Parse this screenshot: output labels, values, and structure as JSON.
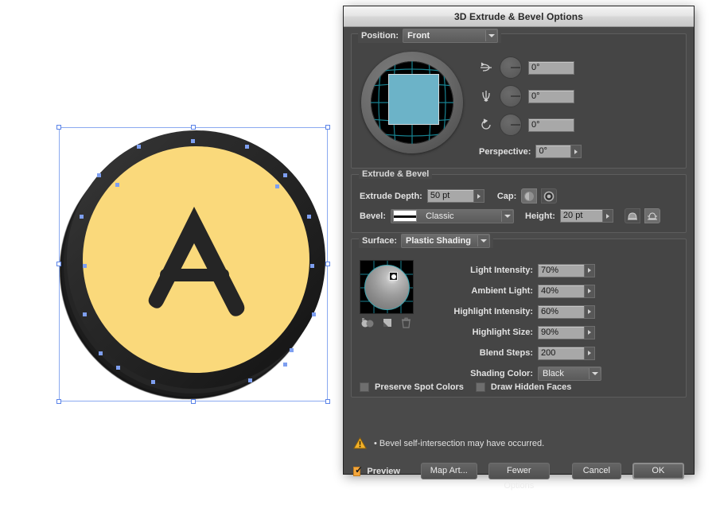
{
  "dialog": {
    "title": "3D Extrude & Bevel Options"
  },
  "position": {
    "label": "Position:",
    "value": "Front",
    "rotation_x": {
      "icon": "rotate-x-axis-icon",
      "value": "0°"
    },
    "rotation_y": {
      "icon": "rotate-y-axis-icon",
      "value": "0°"
    },
    "rotation_z": {
      "icon": "rotate-z-axis-icon",
      "value": "0°"
    },
    "perspective": {
      "label": "Perspective:",
      "value": "0°"
    }
  },
  "extrude": {
    "legend": "Extrude & Bevel",
    "depth_label": "Extrude Depth:",
    "depth_value": "50 pt",
    "cap_label": "Cap:",
    "cap_solid_icon": "cap-solid-icon",
    "cap_hollow_icon": "cap-hollow-icon",
    "bevel_label": "Bevel:",
    "bevel_value": "Classic",
    "height_label": "Height:",
    "height_value": "20 pt",
    "bevel_out_icon": "bevel-extent-out-icon",
    "bevel_in_icon": "bevel-extent-in-icon"
  },
  "surface": {
    "legend": "Surface:",
    "shading_value": "Plastic Shading",
    "sphere_icon": "light-sphere-preview",
    "new_light_icon": "new-light-icon",
    "move_light_icon": "move-light-back-icon",
    "delete_light_icon": "delete-light-icon",
    "fields": [
      {
        "label": "Light Intensity:",
        "value": "70%"
      },
      {
        "label": "Ambient Light:",
        "value": "40%"
      },
      {
        "label": "Highlight Intensity:",
        "value": "60%"
      },
      {
        "label": "Highlight Size:",
        "value": "90%"
      },
      {
        "label": "Blend Steps:",
        "value": "200"
      }
    ],
    "shading_color_label": "Shading Color:",
    "shading_color_value": "Black",
    "preserve_spot_colors": "Preserve Spot Colors",
    "draw_hidden_faces": "Draw Hidden Faces"
  },
  "warning": {
    "icon": "warning-triangle-icon",
    "text": "• Bevel self-intersection may have occurred."
  },
  "footer": {
    "preview_label": "Preview",
    "preview_checked": true,
    "map_art": "Map Art...",
    "fewer_options": "Fewer Options",
    "cancel": "Cancel",
    "ok": "OK"
  },
  "artwork": {
    "name": "extruded-coin-artwork",
    "letter": "A",
    "face_color": "#fad97b",
    "edge_color": "#252525",
    "selection_color": "#7e9ff0"
  },
  "colors": {
    "accent_orange": "#f4a73c",
    "cube_face": "#6cb3c8",
    "panel_bg": "#4a4a4a",
    "field_bg": "#a8a8a8"
  }
}
